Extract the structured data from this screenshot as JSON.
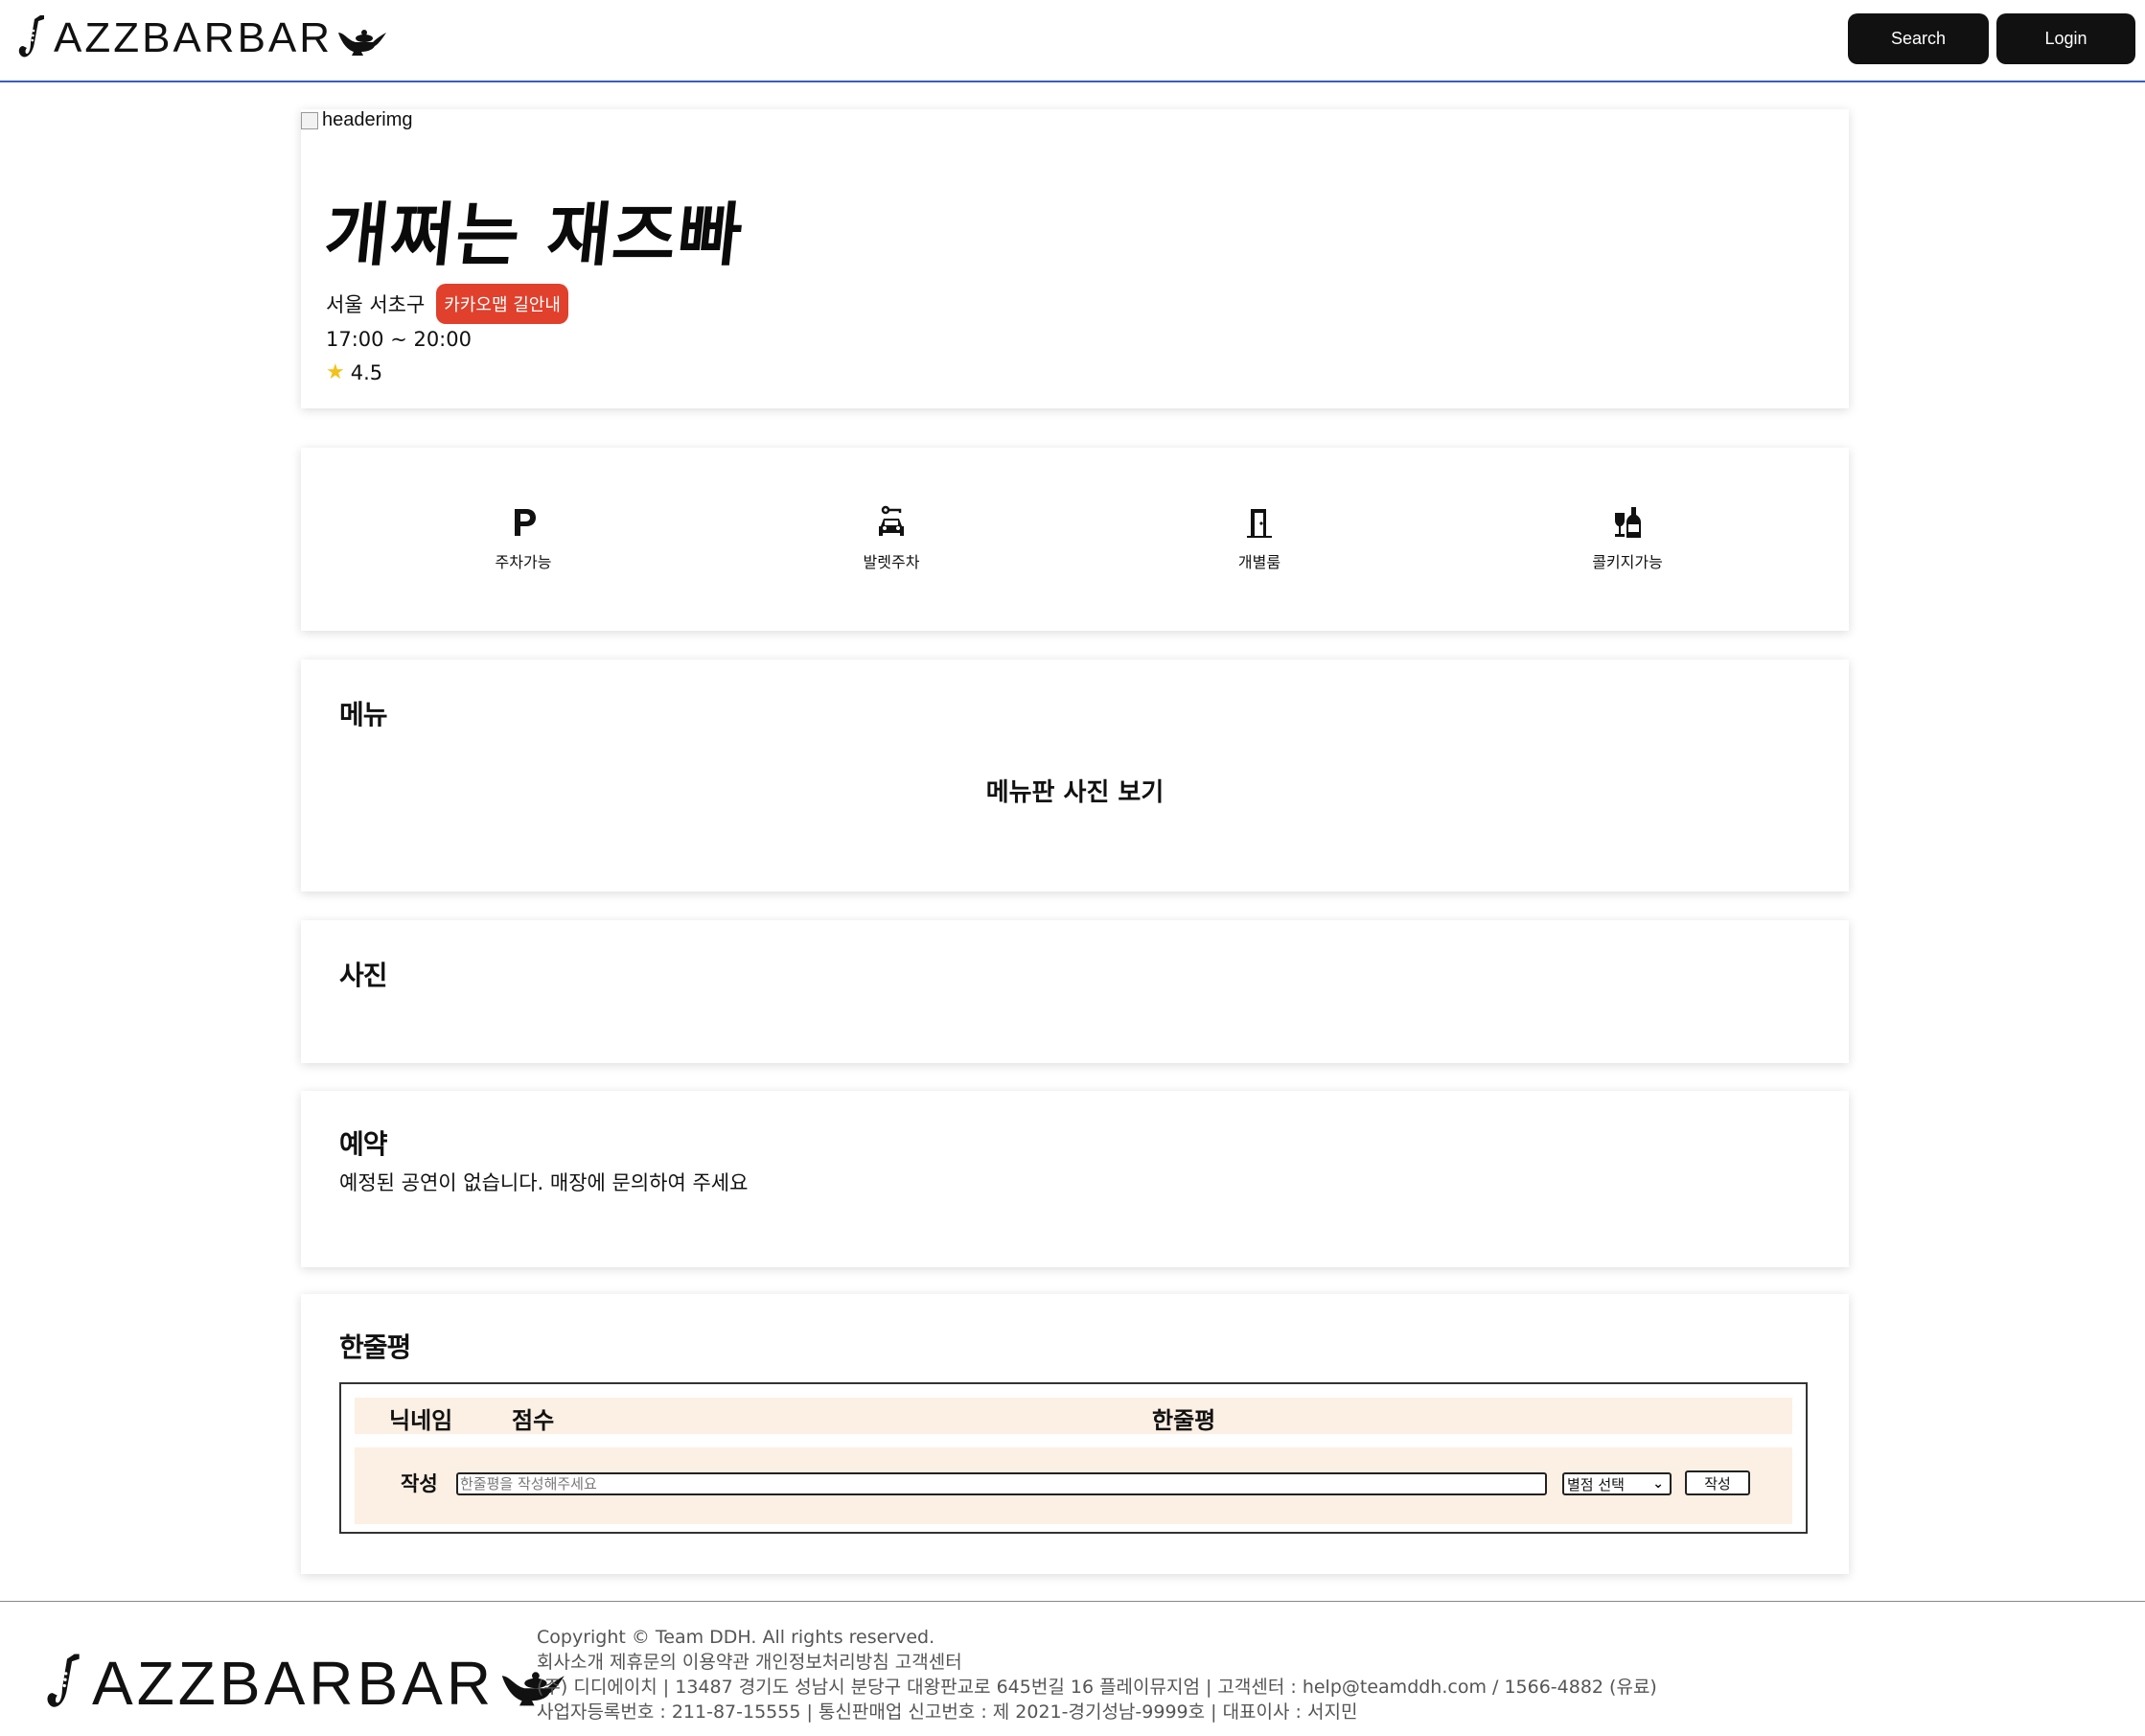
{
  "header": {
    "logo_text": "AZZBARBAR",
    "search_label": "Search",
    "login_label": "Login"
  },
  "bar": {
    "header_image_alt": "headerimg",
    "name": "개쩌는 재즈빠",
    "location": "서울 서초구",
    "map_button": "카카오맵 길안내",
    "hours": "17:00 ~ 20:00",
    "rating": "4.5"
  },
  "amenities": [
    {
      "label": "주차가능",
      "icon": "parking-icon"
    },
    {
      "label": "발렛주차",
      "icon": "valet-car-icon"
    },
    {
      "label": "개별룸",
      "icon": "door-icon"
    },
    {
      "label": "콜키지가능",
      "icon": "wine-bottle-icon"
    }
  ],
  "menu": {
    "title": "메뉴",
    "photo_link": "메뉴판 사진 보기"
  },
  "photos": {
    "title": "사진"
  },
  "reservation": {
    "title": "예약",
    "text": "예정된 공연이 없습니다. 매장에 문의하여 주세요"
  },
  "reviews": {
    "title": "한줄평",
    "columns": [
      "닉네임",
      "점수",
      "한줄평"
    ],
    "form_label": "작성",
    "input_placeholder": "한줄평을 작성해주세요",
    "score_select": "별점 선택",
    "submit_label": "작성"
  },
  "footer": {
    "logo_text": "AZZBARBAR",
    "lines": [
      "Copyright © Team DDH. All rights reserved.",
      "회사소개 제휴문의 이용약관 개인정보처리방침 고객센터",
      "(주) 디디에이치 | 13487 경기도 성남시 분당구 대왕판교로 645번길 16 플레이뮤지엄 | 고객센터 : help@teamddh.com / 1566-4882 (유료)",
      "사업자등록번호 : 211-87-15555 | 통신판매업 신고번호 : 제 2021-경기성남-9999호 | 대표이사 : 서지민"
    ]
  }
}
